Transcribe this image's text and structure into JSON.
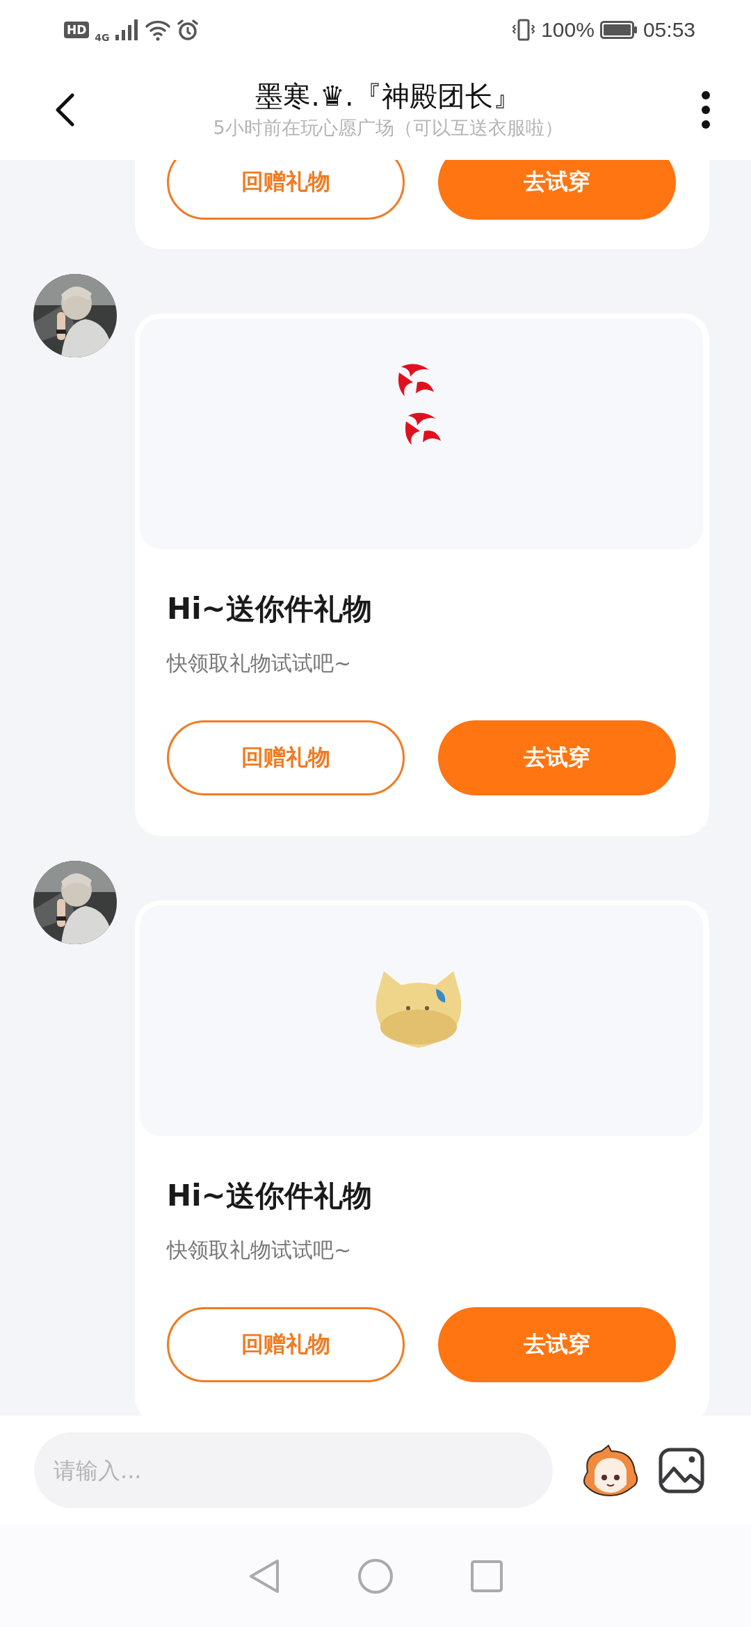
{
  "status_bar": {
    "hd": "HD",
    "network": "4G",
    "battery": "100%",
    "time": "05:53"
  },
  "header": {
    "title": "墨寒.♛.『神殿团长』",
    "subtitle": "5小时前在玩心愿广场（可以互送衣服啦）"
  },
  "messages": [
    {
      "partial": true,
      "buttons": [
        {
          "kind": "outline",
          "label": "回赠礼物"
        },
        {
          "kind": "filled",
          "label": "去试穿"
        }
      ]
    },
    {
      "partial": false,
      "gift": {
        "kind": "picture"
      },
      "title": "Hi~送你件礼物",
      "text": "快领取礼物试试吧~",
      "buttons": [
        {
          "kind": "outline",
          "label": "回赠礼物"
        },
        {
          "kind": "filled",
          "label": "去试穿"
        }
      ]
    },
    {
      "partial": false,
      "gift": {
        "kind": "picture"
      },
      "title": "Hi~送你件礼物",
      "text": "快领取礼物试试吧~",
      "buttons": [
        {
          "kind": "outline",
          "label": "回赠礼物"
        },
        {
          "kind": "filled",
          "label": "去试穿"
        }
      ]
    }
  ],
  "composer": {
    "placeholder": "请输入..."
  }
}
